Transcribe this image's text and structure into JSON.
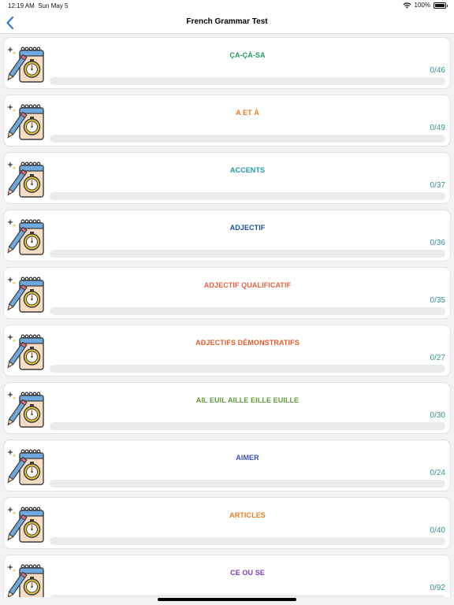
{
  "status_bar": {
    "time": "12:19 AM",
    "date": "Sun May 5",
    "battery": "100%"
  },
  "nav": {
    "title": "French Grammar Test",
    "back_icon": "chevron-left-icon"
  },
  "topics": [
    {
      "title": "ÇA-ÇÀ-SA",
      "count": "0/46",
      "color": "#1e9e5c",
      "progress": 0
    },
    {
      "title": "A ET À",
      "count": "0/49",
      "color": "#ee7a1d",
      "progress": 0
    },
    {
      "title": "ACCENTS",
      "count": "0/37",
      "color": "#1d9aa8",
      "progress": 0
    },
    {
      "title": "ADJECTIF",
      "count": "0/36",
      "color": "#1e4f93",
      "progress": 0
    },
    {
      "title": "ADJECTIF QUALIFICATIF",
      "count": "0/35",
      "color": "#e8613f",
      "progress": 0
    },
    {
      "title": "ADJECTIFS DÉMONSTRATIFS",
      "count": "0/27",
      "color": "#e8592a",
      "progress": 0
    },
    {
      "title": "AIL EUIL AILLE EILLE EUILLE",
      "count": "0/30",
      "color": "#5e9c34",
      "progress": 0
    },
    {
      "title": "AIMER",
      "count": "0/24",
      "color": "#3b4fb0",
      "progress": 0
    },
    {
      "title": "ARTICLES",
      "count": "0/40",
      "color": "#ee7a1d",
      "progress": 0
    },
    {
      "title": "CE OU SE",
      "count": "0/92",
      "color": "#7d39b5",
      "progress": 0
    }
  ],
  "icons": {
    "topic": "notebook-stopwatch-pencil-icon",
    "wifi": "wifi-icon",
    "battery": "battery-icon"
  }
}
